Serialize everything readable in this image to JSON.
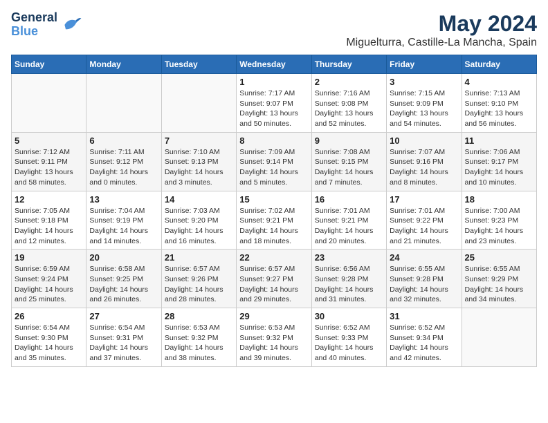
{
  "header": {
    "logo_line1": "General",
    "logo_line2": "Blue",
    "title": "May 2024",
    "subtitle": "Miguelturra, Castille-La Mancha, Spain"
  },
  "weekdays": [
    "Sunday",
    "Monday",
    "Tuesday",
    "Wednesday",
    "Thursday",
    "Friday",
    "Saturday"
  ],
  "weeks": [
    [
      {
        "day": "",
        "sunrise": "",
        "sunset": "",
        "daylight": ""
      },
      {
        "day": "",
        "sunrise": "",
        "sunset": "",
        "daylight": ""
      },
      {
        "day": "",
        "sunrise": "",
        "sunset": "",
        "daylight": ""
      },
      {
        "day": "1",
        "sunrise": "7:17 AM",
        "sunset": "9:07 PM",
        "daylight": "13 hours and 50 minutes."
      },
      {
        "day": "2",
        "sunrise": "7:16 AM",
        "sunset": "9:08 PM",
        "daylight": "13 hours and 52 minutes."
      },
      {
        "day": "3",
        "sunrise": "7:15 AM",
        "sunset": "9:09 PM",
        "daylight": "13 hours and 54 minutes."
      },
      {
        "day": "4",
        "sunrise": "7:13 AM",
        "sunset": "9:10 PM",
        "daylight": "13 hours and 56 minutes."
      }
    ],
    [
      {
        "day": "5",
        "sunrise": "7:12 AM",
        "sunset": "9:11 PM",
        "daylight": "13 hours and 58 minutes."
      },
      {
        "day": "6",
        "sunrise": "7:11 AM",
        "sunset": "9:12 PM",
        "daylight": "14 hours and 0 minutes."
      },
      {
        "day": "7",
        "sunrise": "7:10 AM",
        "sunset": "9:13 PM",
        "daylight": "14 hours and 3 minutes."
      },
      {
        "day": "8",
        "sunrise": "7:09 AM",
        "sunset": "9:14 PM",
        "daylight": "14 hours and 5 minutes."
      },
      {
        "day": "9",
        "sunrise": "7:08 AM",
        "sunset": "9:15 PM",
        "daylight": "14 hours and 7 minutes."
      },
      {
        "day": "10",
        "sunrise": "7:07 AM",
        "sunset": "9:16 PM",
        "daylight": "14 hours and 8 minutes."
      },
      {
        "day": "11",
        "sunrise": "7:06 AM",
        "sunset": "9:17 PM",
        "daylight": "14 hours and 10 minutes."
      }
    ],
    [
      {
        "day": "12",
        "sunrise": "7:05 AM",
        "sunset": "9:18 PM",
        "daylight": "14 hours and 12 minutes."
      },
      {
        "day": "13",
        "sunrise": "7:04 AM",
        "sunset": "9:19 PM",
        "daylight": "14 hours and 14 minutes."
      },
      {
        "day": "14",
        "sunrise": "7:03 AM",
        "sunset": "9:20 PM",
        "daylight": "14 hours and 16 minutes."
      },
      {
        "day": "15",
        "sunrise": "7:02 AM",
        "sunset": "9:21 PM",
        "daylight": "14 hours and 18 minutes."
      },
      {
        "day": "16",
        "sunrise": "7:01 AM",
        "sunset": "9:21 PM",
        "daylight": "14 hours and 20 minutes."
      },
      {
        "day": "17",
        "sunrise": "7:01 AM",
        "sunset": "9:22 PM",
        "daylight": "14 hours and 21 minutes."
      },
      {
        "day": "18",
        "sunrise": "7:00 AM",
        "sunset": "9:23 PM",
        "daylight": "14 hours and 23 minutes."
      }
    ],
    [
      {
        "day": "19",
        "sunrise": "6:59 AM",
        "sunset": "9:24 PM",
        "daylight": "14 hours and 25 minutes."
      },
      {
        "day": "20",
        "sunrise": "6:58 AM",
        "sunset": "9:25 PM",
        "daylight": "14 hours and 26 minutes."
      },
      {
        "day": "21",
        "sunrise": "6:57 AM",
        "sunset": "9:26 PM",
        "daylight": "14 hours and 28 minutes."
      },
      {
        "day": "22",
        "sunrise": "6:57 AM",
        "sunset": "9:27 PM",
        "daylight": "14 hours and 29 minutes."
      },
      {
        "day": "23",
        "sunrise": "6:56 AM",
        "sunset": "9:28 PM",
        "daylight": "14 hours and 31 minutes."
      },
      {
        "day": "24",
        "sunrise": "6:55 AM",
        "sunset": "9:28 PM",
        "daylight": "14 hours and 32 minutes."
      },
      {
        "day": "25",
        "sunrise": "6:55 AM",
        "sunset": "9:29 PM",
        "daylight": "14 hours and 34 minutes."
      }
    ],
    [
      {
        "day": "26",
        "sunrise": "6:54 AM",
        "sunset": "9:30 PM",
        "daylight": "14 hours and 35 minutes."
      },
      {
        "day": "27",
        "sunrise": "6:54 AM",
        "sunset": "9:31 PM",
        "daylight": "14 hours and 37 minutes."
      },
      {
        "day": "28",
        "sunrise": "6:53 AM",
        "sunset": "9:32 PM",
        "daylight": "14 hours and 38 minutes."
      },
      {
        "day": "29",
        "sunrise": "6:53 AM",
        "sunset": "9:32 PM",
        "daylight": "14 hours and 39 minutes."
      },
      {
        "day": "30",
        "sunrise": "6:52 AM",
        "sunset": "9:33 PM",
        "daylight": "14 hours and 40 minutes."
      },
      {
        "day": "31",
        "sunrise": "6:52 AM",
        "sunset": "9:34 PM",
        "daylight": "14 hours and 42 minutes."
      },
      {
        "day": "",
        "sunrise": "",
        "sunset": "",
        "daylight": ""
      }
    ]
  ]
}
